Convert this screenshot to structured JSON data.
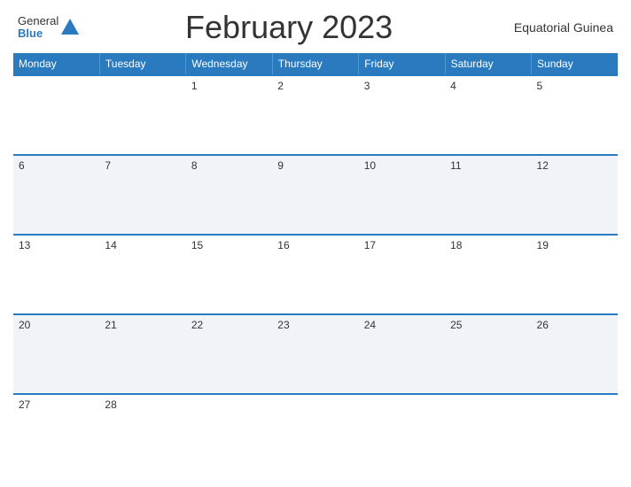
{
  "header": {
    "logo_general": "General",
    "logo_blue": "Blue",
    "title": "February 2023",
    "country": "Equatorial Guinea"
  },
  "days_of_week": [
    "Monday",
    "Tuesday",
    "Wednesday",
    "Thursday",
    "Friday",
    "Saturday",
    "Sunday"
  ],
  "weeks": [
    [
      null,
      null,
      1,
      2,
      3,
      4,
      5
    ],
    [
      6,
      7,
      8,
      9,
      10,
      11,
      12
    ],
    [
      13,
      14,
      15,
      16,
      17,
      18,
      19
    ],
    [
      20,
      21,
      22,
      23,
      24,
      25,
      26
    ],
    [
      27,
      28,
      null,
      null,
      null,
      null,
      null
    ]
  ]
}
